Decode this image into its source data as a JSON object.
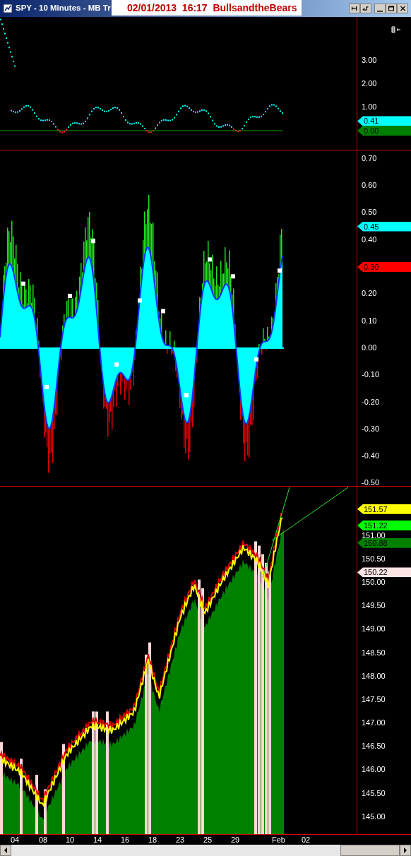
{
  "window": {
    "title": "SPY - 10 Minutes - MB Tr",
    "caption": "02/01/2013  16:17  BullsandtheBears"
  },
  "panels": [
    {
      "yticks": [
        "3.00",
        "2.00",
        "1.00"
      ],
      "markers": [
        {
          "label": "0.41",
          "color": "#00ffff"
        },
        {
          "label": "0.00",
          "color": "#008000"
        }
      ]
    },
    {
      "yticks": [
        "0.70",
        "0.60",
        "0.50",
        "0.40",
        "0.20",
        "0.10",
        "0.00",
        "-0.10",
        "-0.20",
        "-0.30",
        "-0.40",
        "-0.50"
      ],
      "markers": [
        {
          "label": "0.45",
          "color": "#00ffff"
        },
        {
          "label": "0.30",
          "color": "#ff0000"
        }
      ]
    },
    {
      "yticks": [
        "151.00",
        "150.50",
        "150.00",
        "149.50",
        "149.00",
        "148.50",
        "148.00",
        "147.50",
        "147.00",
        "146.50",
        "146.00",
        "145.50",
        "145.00"
      ],
      "markers": [
        {
          "label": "151.57",
          "color": "#ffff00"
        },
        {
          "label": "151.22",
          "color": "#00ff00"
        },
        {
          "label": "150.88",
          "color": "#008000"
        },
        {
          "label": "150.22",
          "color": "#ffe4e4"
        }
      ]
    }
  ],
  "x_axis": {
    "labels": [
      "04",
      "08",
      "10",
      "14",
      "16",
      "18",
      "23",
      "25",
      "29",
      "Feb",
      "02"
    ]
  }
}
